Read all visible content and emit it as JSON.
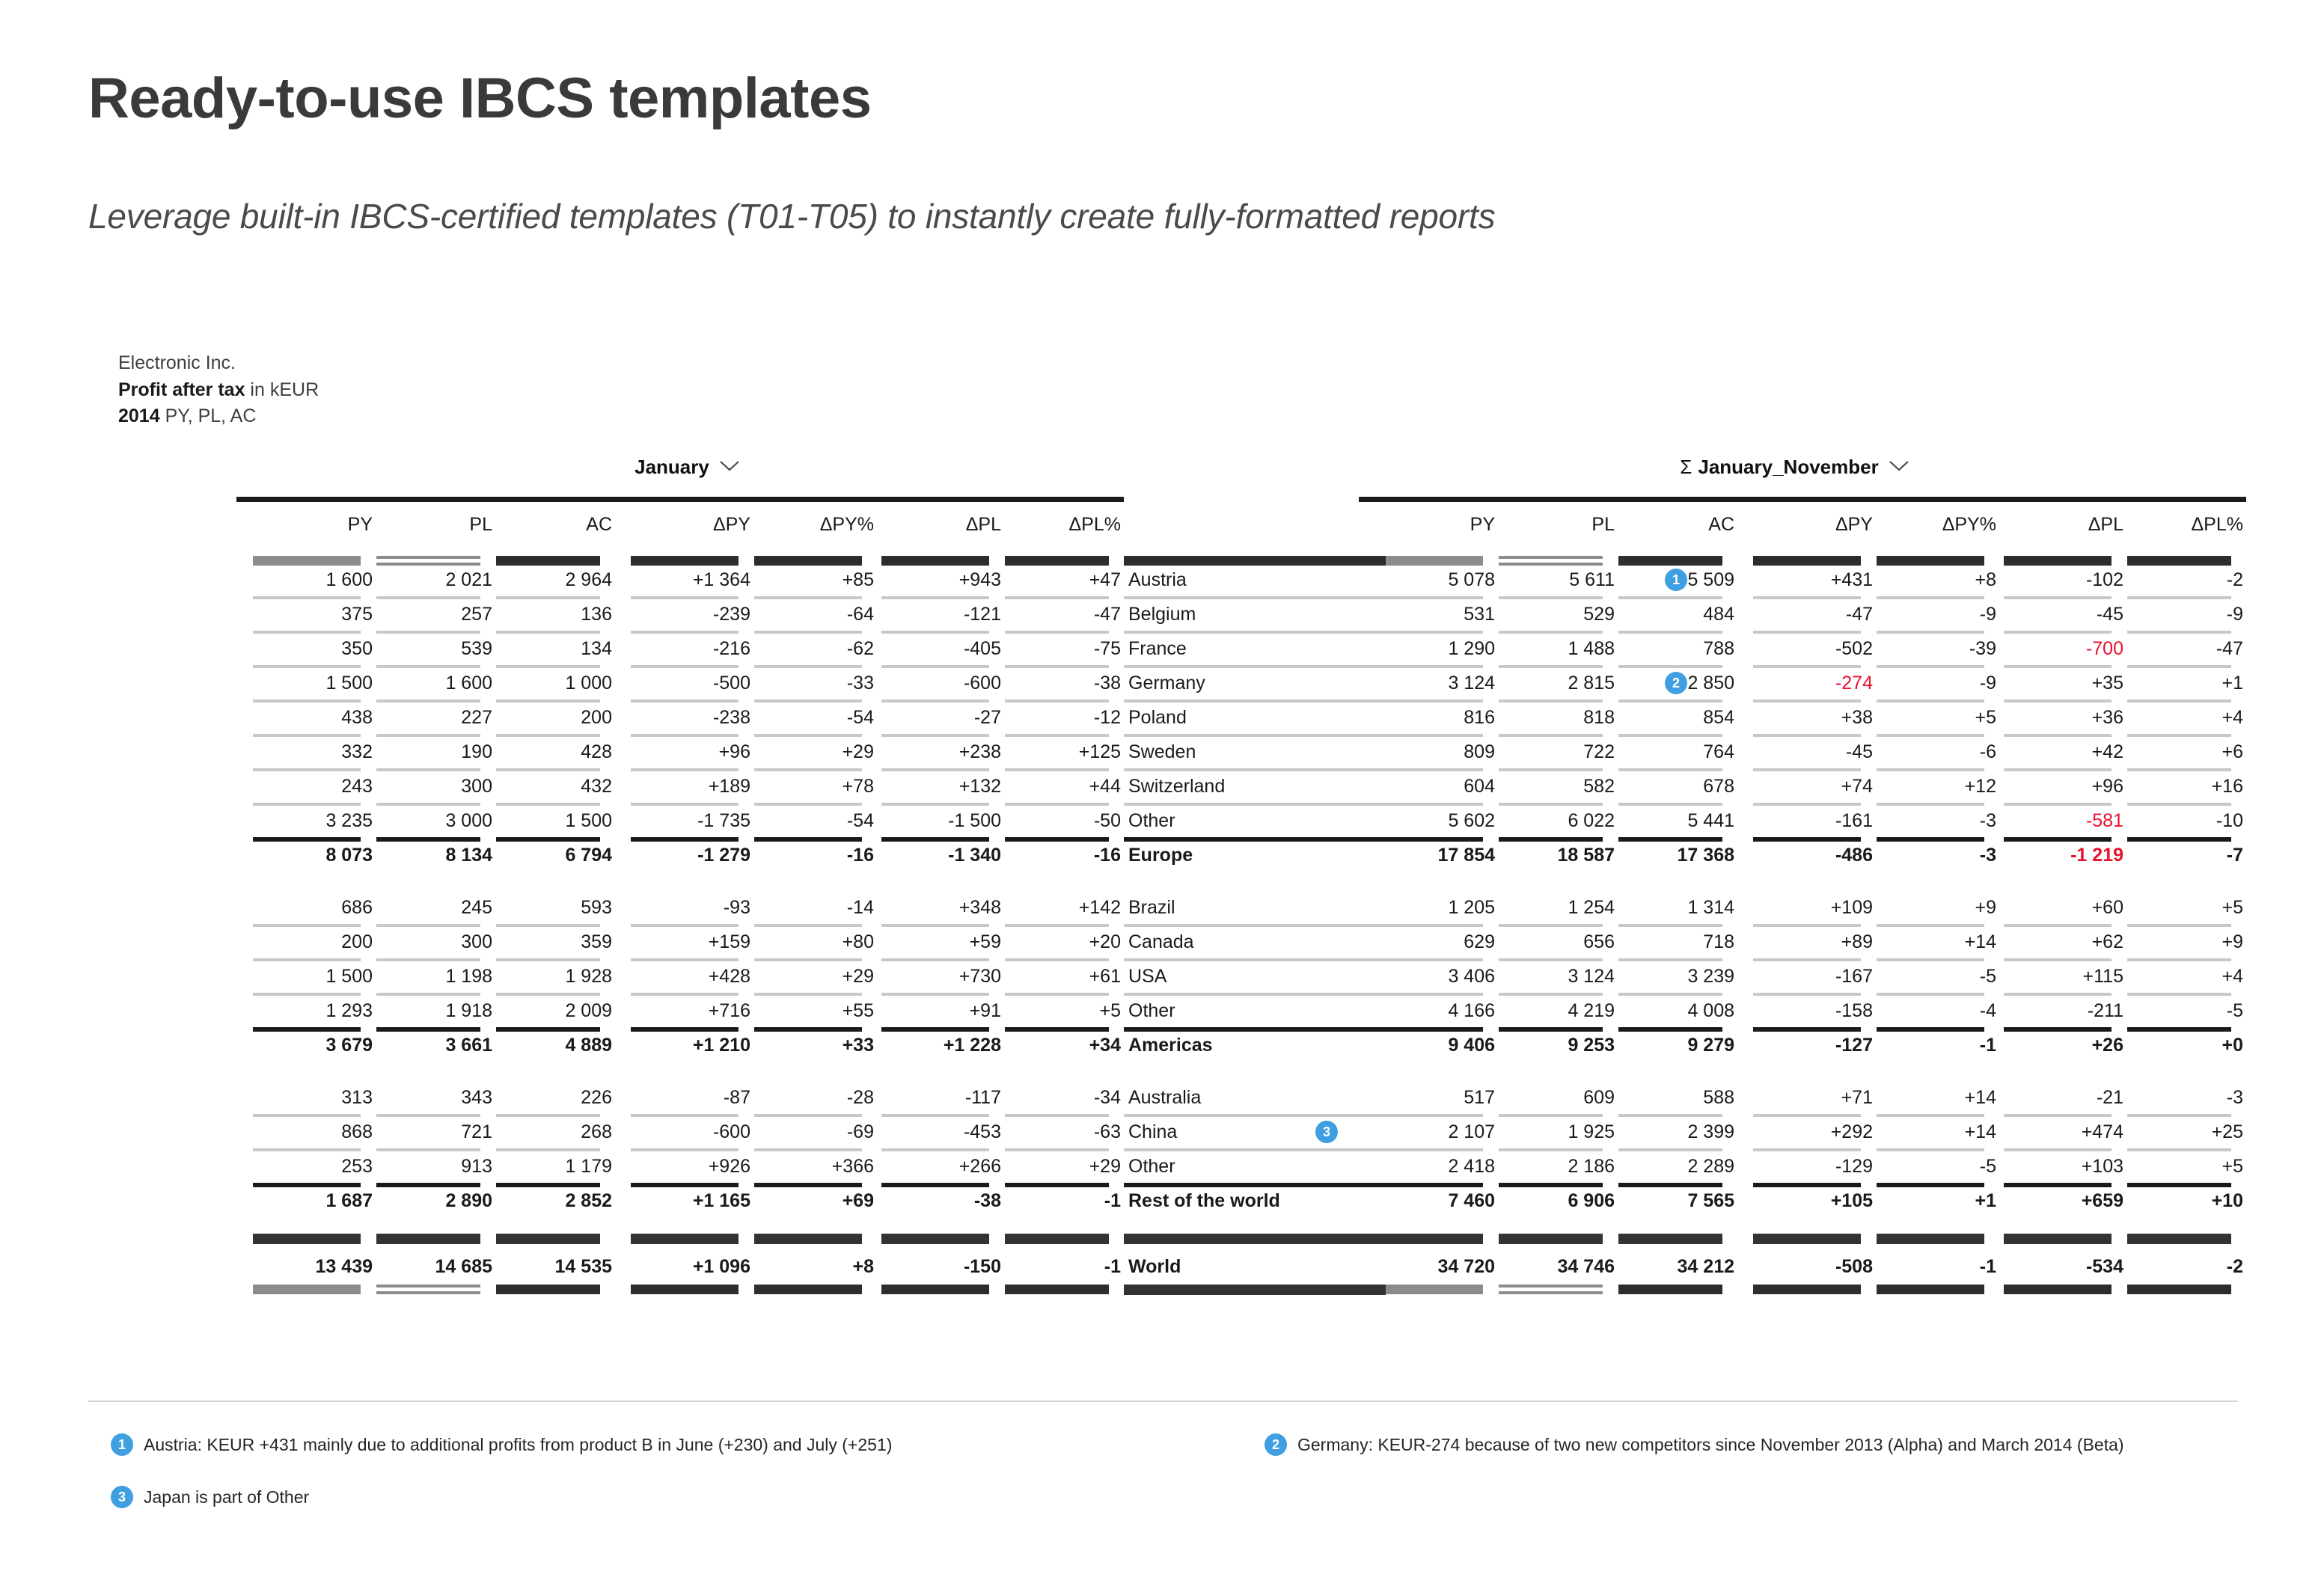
{
  "header": {
    "title": "Ready-to-use IBCS templates",
    "subtitle": "Leverage built-in IBCS-certified templates (T01-T05) to instantly create fully-formatted reports"
  },
  "report_head": {
    "company": "Electronic Inc.",
    "measure": "Profit after tax",
    "measure_unit": " in kEUR",
    "year": "2014",
    "scenarios": " PY, PL, AC"
  },
  "panels": [
    {
      "id": "left",
      "sigma": "",
      "title": "January",
      "chevron": "chevron-down-icon"
    },
    {
      "id": "right",
      "sigma": "Σ",
      "title": "January_November",
      "chevron": "chevron-down-icon"
    }
  ],
  "columns": [
    "PY",
    "PL",
    "AC",
    "ΔPY",
    "ΔPY%",
    "ΔPL",
    "ΔPL%"
  ],
  "column_markers": [
    "py",
    "pl",
    "ac",
    "delta",
    "delta",
    "delta",
    "delta"
  ],
  "groups": [
    {
      "rows": [
        "Austria",
        "Belgium",
        "France",
        "Germany",
        "Poland",
        "Sweden",
        "Switzerland",
        "Other"
      ],
      "total": "Europe"
    },
    {
      "rows": [
        "Brazil",
        "Canada",
        "USA",
        "Other"
      ],
      "total": "Americas"
    },
    {
      "rows": [
        "Australia",
        "China",
        "Other"
      ],
      "total": "Rest of the world"
    }
  ],
  "grand_total": "World",
  "left_table": {
    "data": [
      [
        "1 600",
        "2 021",
        "2 964",
        "+1 364",
        "+85",
        "+943",
        "+47"
      ],
      [
        "375",
        "257",
        "136",
        "-239",
        "-64",
        "-121",
        "-47"
      ],
      [
        "350",
        "539",
        "134",
        "-216",
        "-62",
        "-405",
        "-75"
      ],
      [
        "1 500",
        "1 600",
        "1 000",
        "-500",
        "-33",
        "-600",
        "-38"
      ],
      [
        "438",
        "227",
        "200",
        "-238",
        "-54",
        "-27",
        "-12"
      ],
      [
        "332",
        "190",
        "428",
        "+96",
        "+29",
        "+238",
        "+125"
      ],
      [
        "243",
        "300",
        "432",
        "+189",
        "+78",
        "+132",
        "+44"
      ],
      [
        "3 235",
        "3 000",
        "1 500",
        "-1 735",
        "-54",
        "-1 500",
        "-50"
      ]
    ],
    "total": [
      "8 073",
      "8 134",
      "6 794",
      "-1 279",
      "-16",
      "-1 340",
      "-16"
    ],
    "data2": [
      [
        "686",
        "245",
        "593",
        "-93",
        "-14",
        "+348",
        "+142"
      ],
      [
        "200",
        "300",
        "359",
        "+159",
        "+80",
        "+59",
        "+20"
      ],
      [
        "1 500",
        "1 198",
        "1 928",
        "+428",
        "+29",
        "+730",
        "+61"
      ],
      [
        "1 293",
        "1 918",
        "2 009",
        "+716",
        "+55",
        "+91",
        "+5"
      ]
    ],
    "total2": [
      "3 679",
      "3 661",
      "4 889",
      "+1 210",
      "+33",
      "+1 228",
      "+34"
    ],
    "data3": [
      [
        "313",
        "343",
        "226",
        "-87",
        "-28",
        "-117",
        "-34"
      ],
      [
        "868",
        "721",
        "268",
        "-600",
        "-69",
        "-453",
        "-63"
      ],
      [
        "253",
        "913",
        "1 179",
        "+926",
        "+366",
        "+266",
        "+29"
      ]
    ],
    "total3": [
      "1 687",
      "2 890",
      "2 852",
      "+1 165",
      "+69",
      "-38",
      "-1"
    ],
    "world": [
      "13 439",
      "14 685",
      "14 535",
      "+1 096",
      "+8",
      "-150",
      "-1"
    ]
  },
  "right_table": {
    "data": [
      [
        "5 078",
        "5 611",
        "5 509",
        "+431",
        "+8",
        "-102",
        "-2"
      ],
      [
        "531",
        "529",
        "484",
        "-47",
        "-9",
        "-45",
        "-9"
      ],
      [
        "1 290",
        "1 488",
        "788",
        "-502",
        "-39",
        "-700",
        "-47"
      ],
      [
        "3 124",
        "2 815",
        "2 850",
        "-274",
        "-9",
        "+35",
        "+1"
      ],
      [
        "816",
        "818",
        "854",
        "+38",
        "+5",
        "+36",
        "+4"
      ],
      [
        "809",
        "722",
        "764",
        "-45",
        "-6",
        "+42",
        "+6"
      ],
      [
        "604",
        "582",
        "678",
        "+74",
        "+12",
        "+96",
        "+16"
      ],
      [
        "5 602",
        "6 022",
        "5 441",
        "-161",
        "-3",
        "-581",
        "-10"
      ]
    ],
    "total": [
      "17 854",
      "18 587",
      "17 368",
      "-486",
      "-3",
      "-1 219",
      "-7"
    ],
    "data2": [
      [
        "1 205",
        "1 254",
        "1 314",
        "+109",
        "+9",
        "+60",
        "+5"
      ],
      [
        "629",
        "656",
        "718",
        "+89",
        "+14",
        "+62",
        "+9"
      ],
      [
        "3 406",
        "3 124",
        "3 239",
        "-167",
        "-5",
        "+115",
        "+4"
      ],
      [
        "4 166",
        "4 219",
        "4 008",
        "-158",
        "-4",
        "-211",
        "-5"
      ]
    ],
    "total2": [
      "9 406",
      "9 253",
      "9 279",
      "-127",
      "-1",
      "+26",
      "+0"
    ],
    "data3": [
      [
        "517",
        "609",
        "588",
        "+71",
        "+14",
        "-21",
        "-3"
      ],
      [
        "2 107",
        "1 925",
        "2 399",
        "+292",
        "+14",
        "+474",
        "+25"
      ],
      [
        "2 418",
        "2 186",
        "2 289",
        "-129",
        "-5",
        "+103",
        "+5"
      ]
    ],
    "total3": [
      "7 460",
      "6 906",
      "7 565",
      "+105",
      "+1",
      "+659",
      "+10"
    ],
    "world": [
      "34 720",
      "34 746",
      "34 212",
      "-508",
      "-1",
      "-534",
      "-2"
    ]
  },
  "highlight_red": {
    "right": [
      [
        "2",
        "5"
      ],
      [
        "7",
        "5"
      ],
      [
        "t1",
        "5"
      ],
      [
        "3",
        "3"
      ]
    ]
  },
  "markers": {
    "one": "1",
    "two": "2",
    "three": "3"
  },
  "footnotes": [
    {
      "n": "1",
      "text": "Austria: KEUR +431 mainly due to additional profits from product B in June (+230) and July (+251)"
    },
    {
      "n": "3",
      "text": "Japan is part of Other"
    },
    {
      "n": "2",
      "text": "Germany: KEUR-274 because of two new competitors since November 2013 (Alpha) and March 2014 (Beta)"
    }
  ],
  "colors": {
    "accent": "#3f9fe0",
    "negative": "#e8112d",
    "py_bar": "#8c8c8c",
    "ac_bar": "#2d2d2d"
  }
}
